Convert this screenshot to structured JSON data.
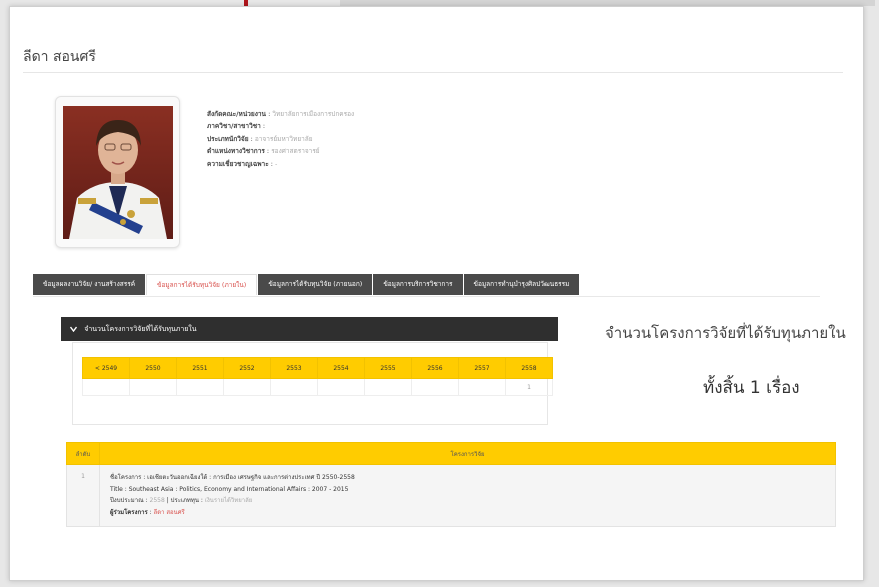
{
  "profile": {
    "name": "ลีดา สอนศรี",
    "info": [
      {
        "label": "สังกัดคณะ/หน่วยงาน",
        "value": "วิทยาลัยการเมืองการปกครอง"
      },
      {
        "label": "ภาควิชา/สาขาวิชา",
        "value": ""
      },
      {
        "label": "ประเภทนักวิจัย",
        "value": "อาจารย์มหาวิทยาลัย"
      },
      {
        "label": "ตำแหน่งทางวิชาการ",
        "value": "รองศาสตราจารย์"
      },
      {
        "label": "ความเชี่ยวชาญเฉพาะ",
        "value": "-"
      }
    ]
  },
  "tabs": [
    {
      "label": "ข้อมูลผลงานวิจัย/ งานสร้างสรรค์",
      "active": false
    },
    {
      "label": "ข้อมูลการได้รับทุนวิจัย (ภายใน)",
      "active": true
    },
    {
      "label": "ข้อมูลการได้รับทุนวิจัย (ภายนอก)",
      "active": false
    },
    {
      "label": "ข้อมูลการบริการวิชาการ",
      "active": false
    },
    {
      "label": "ข้อมูลการทำนุบำรุงศิลปวัฒนธรรม",
      "active": false
    }
  ],
  "section": {
    "dropdown_label": "จำนวนโครงการวิจัยที่ได้รับทุนภายใน",
    "dropdown_icon": "chevron-down-icon",
    "right_title": "จำนวนโครงการวิจัยที่ได้รับทุนภายใน",
    "total": "ทั้งสิ้น 1 เรื่อง"
  },
  "years": {
    "headers": [
      "< 2549",
      "2550",
      "2551",
      "2552",
      "2553",
      "2554",
      "2555",
      "2556",
      "2557",
      "2558"
    ],
    "counts": [
      "",
      "",
      "",
      "",
      "",
      "",
      "",
      "",
      "",
      "1"
    ]
  },
  "projects": {
    "headers": [
      "ลำดับ",
      "โครงการวิจัย"
    ],
    "rows": [
      {
        "index": "1",
        "name_label": "ชื่อโครงการ",
        "name_value": "เอเชียตะวันออกเฉียงใต้ : การเมือง เศรษฐกิจ และการต่างประเทศ ปี 2550-2558",
        "title_label": "Title",
        "title_value": "Southeast Asia : Politics, Economy and International Affairs : 2007 - 2015",
        "budget_label": "ปีงบประมาณ",
        "budget_value": "2558",
        "fund_label": "ประเภททุน",
        "fund_value": "เงินรายได้วิทยาลัย",
        "members_label": "ผู้ร่วมโครงการ",
        "members_value": "ลีดา สอนศรี"
      }
    ]
  },
  "colors": {
    "accent": "#ffcc00",
    "dark": "#2f2f2f",
    "tab": "#4a4a4a",
    "link": "#d9534f",
    "arrow": "#b0161c"
  }
}
